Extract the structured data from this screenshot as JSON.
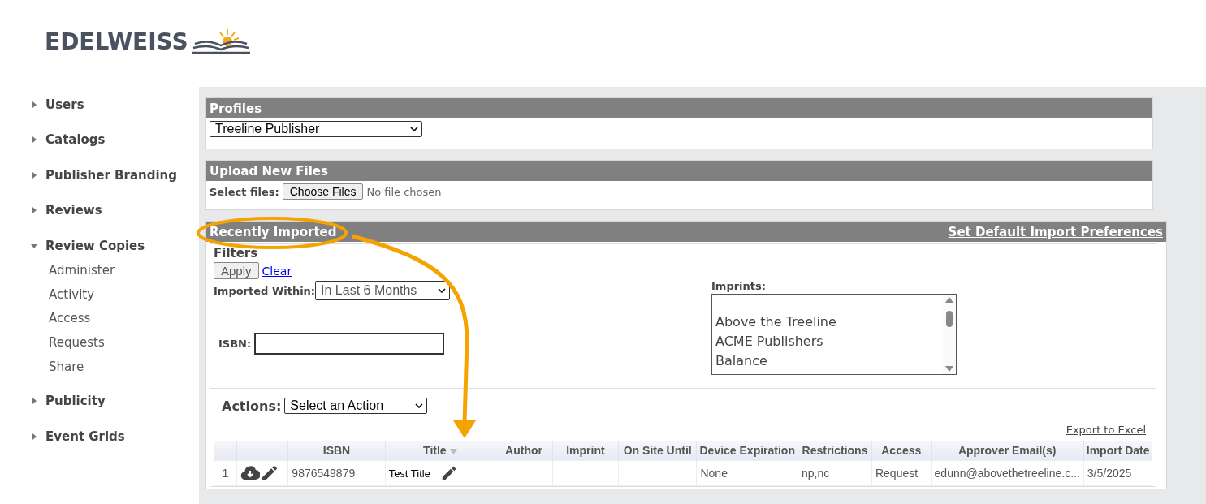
{
  "logo": {
    "text": "EDELWEISS"
  },
  "sidebar": {
    "items": [
      {
        "label": "Users",
        "expanded": false
      },
      {
        "label": "Catalogs",
        "expanded": false
      },
      {
        "label": "Publisher Branding",
        "expanded": false
      },
      {
        "label": "Reviews",
        "expanded": false
      },
      {
        "label": "Review Copies",
        "expanded": true,
        "children": [
          {
            "label": "Administer"
          },
          {
            "label": "Activity"
          },
          {
            "label": "Access"
          },
          {
            "label": "Requests"
          },
          {
            "label": "Share"
          }
        ]
      },
      {
        "label": "Publicity",
        "expanded": false
      },
      {
        "label": "Event Grids",
        "expanded": false
      }
    ]
  },
  "profiles": {
    "title": "Profiles",
    "value": "Treeline Publisher"
  },
  "upload": {
    "title": "Upload New Files",
    "label": "Select files:",
    "button": "Choose Files",
    "status": "No file chosen"
  },
  "recent": {
    "title": "Recently Imported",
    "link": "Set Default Import Preferences",
    "filters": {
      "title": "Filters",
      "apply": "Apply",
      "clear": "Clear",
      "within_label": "Imported Within:",
      "within_value": "In Last 6 Months",
      "isbn_label": "ISBN:",
      "imprints_label": "Imprints:",
      "imprints": [
        "Above the Treeline",
        "ACME Publishers",
        "Balance"
      ]
    },
    "actions": {
      "label": "Actions:",
      "value": "Select an Action"
    },
    "export": "Export to Excel",
    "table": {
      "columns": [
        "",
        "",
        "ISBN",
        "Title",
        "Author",
        "Imprint",
        "On Site Until",
        "Device Expiration",
        "Restrictions",
        "Access",
        "Approver Email(s)",
        "Import Date"
      ],
      "rows": [
        {
          "number": "1",
          "isbn": "9876549879",
          "title": "Test Title",
          "author": "",
          "imprint": "",
          "on_site_until": "",
          "device_expiration": "None",
          "restrictions": "np,nc",
          "access": "Request",
          "approver": "edunn@abovethetreeline.c...",
          "import_date": "3/5/2025"
        }
      ]
    }
  }
}
